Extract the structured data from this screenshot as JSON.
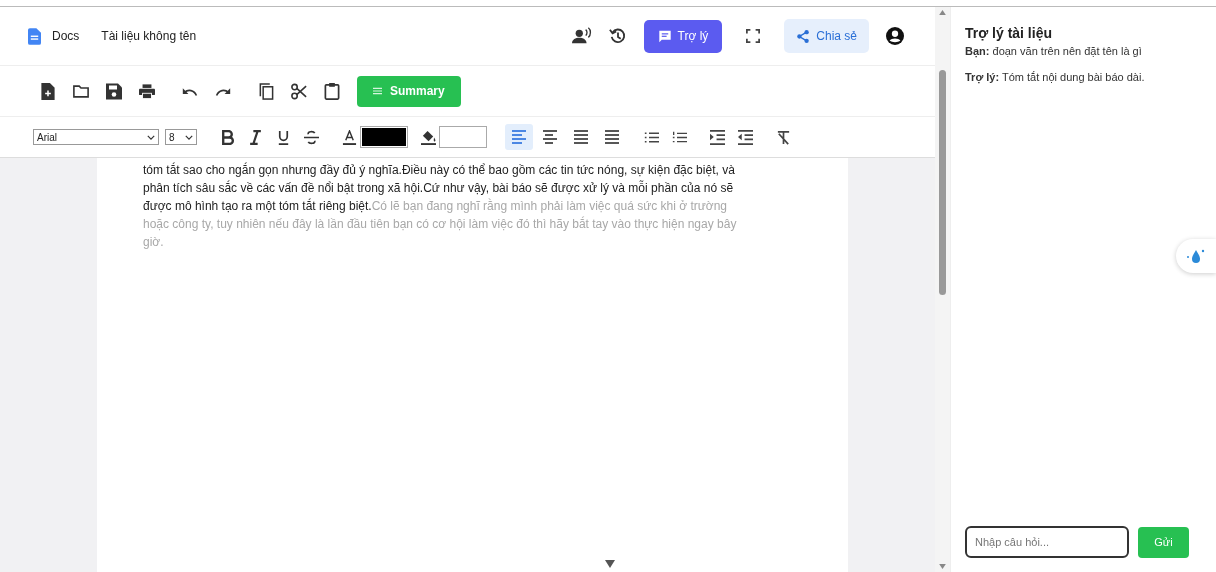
{
  "header": {
    "app_name": "Docs",
    "doc_title": "Tài liệu không tên",
    "assistant_button": "Trợ lý",
    "share_button": "Chia sẻ"
  },
  "toolbar": {
    "summary_button": "Summary"
  },
  "format_bar": {
    "font": "Arial",
    "size": "8",
    "alignments": [
      {
        "selected": true
      },
      {
        "selected": false
      },
      {
        "selected": false
      },
      {
        "selected": false
      }
    ]
  },
  "document": {
    "text": "tóm tắt sao cho ngắn gọn nhưng đầy đủ ý nghĩa.Điều này có thể bao gồm các tin tức nóng, sự kiện đặc biệt, và phân tích sâu sắc về các vấn đề nổi bật trong xã hội.Cứ như vậy, bài báo sẽ được xử lý và mỗi phần của nó sẽ được mô hình tạo ra một tóm tắt riêng biệt.",
    "suggestion": "Có lẽ bạn đang nghĩ rằng mình phải làm việc quá sức khi ở trường hoặc công ty, tuy nhiên nếu đây là lần đầu tiên bạn có cơ hội làm việc đó thì hãy bắt tay vào thực hiện ngay bây giờ."
  },
  "assistant_panel": {
    "title": "Trợ lý tài liệu",
    "messages": [
      {
        "sender": "Bạn:",
        "text": "đoạn văn trên nên đặt tên là gì"
      },
      {
        "sender": "Trợ lý:",
        "text": "Tóm tắt nội dung bài báo dài."
      }
    ],
    "input": {
      "placeholder": "Nhập câu hỏi..."
    },
    "send_button": "Gửi"
  }
}
